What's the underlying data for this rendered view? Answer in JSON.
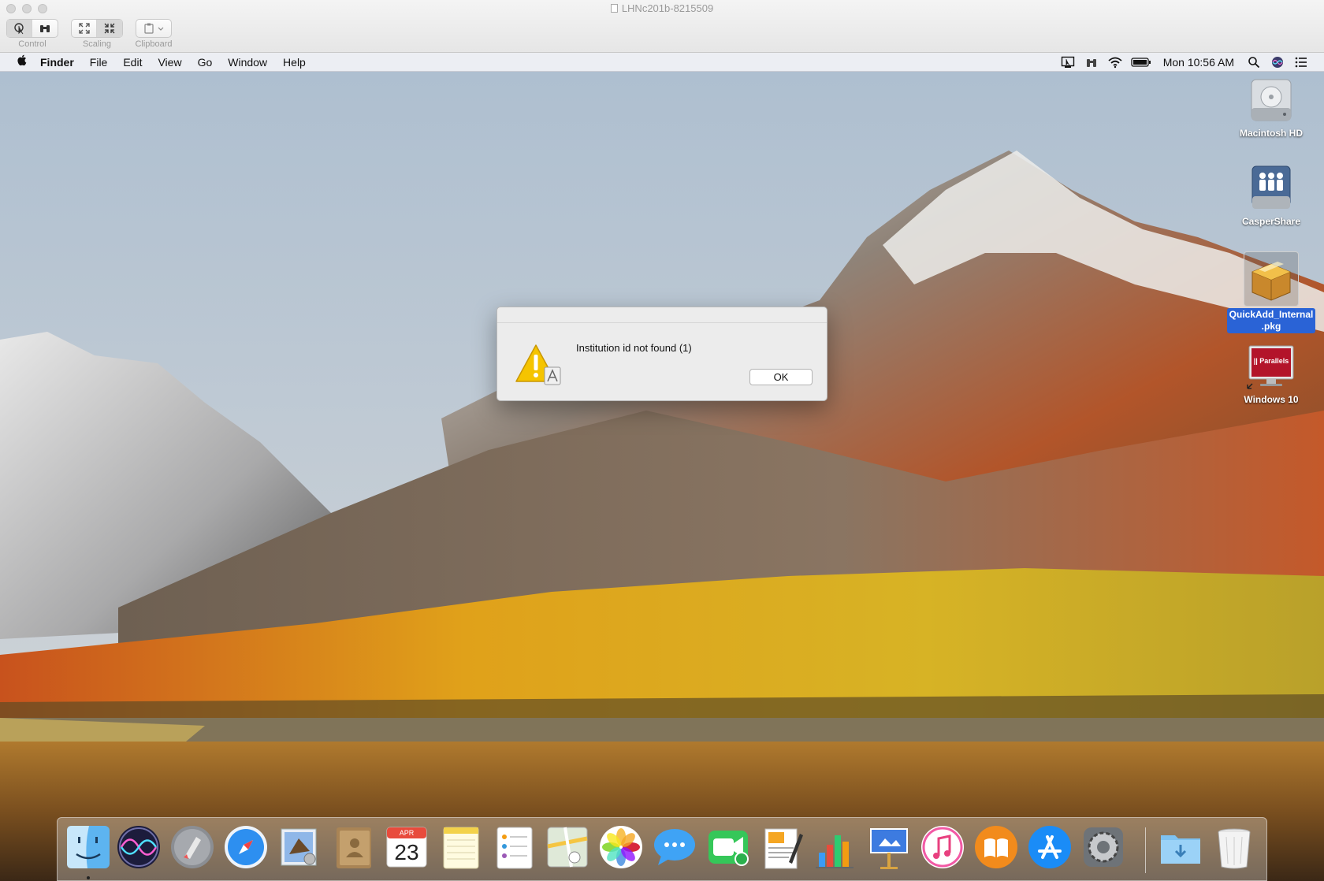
{
  "viewer": {
    "title": "LHNc201b-8215509",
    "tools": {
      "control_label": "Control",
      "scaling_label": "Scaling",
      "clipboard_label": "Clipboard"
    }
  },
  "menubar": {
    "app_name": "Finder",
    "items": [
      "File",
      "Edit",
      "View",
      "Go",
      "Window",
      "Help"
    ],
    "clock": "Mon 10:56 AM"
  },
  "alert": {
    "message": "Institution id not found (1)",
    "ok_label": "OK"
  },
  "desktop_icons": [
    {
      "label": "Macintosh HD"
    },
    {
      "label": "CasperShare"
    },
    {
      "label": "QuickAdd_Internal\n.pkg",
      "line1": "QuickAdd_Internal",
      "line2": ".pkg",
      "selected": true
    },
    {
      "label": "Windows 10",
      "badge": "|| Parallels"
    }
  ],
  "dock": {
    "calendar_month": "APR",
    "calendar_day": "23",
    "apps": [
      "finder-icon",
      "siri-icon",
      "launchpad-icon",
      "safari-icon",
      "mail-icon",
      "contacts-icon",
      "calendar-icon",
      "notes-icon",
      "reminders-icon",
      "maps-icon",
      "photos-icon",
      "messages-icon",
      "facetime-icon",
      "pages-icon",
      "numbers-icon",
      "keynote-icon",
      "itunes-icon",
      "ibooks-icon",
      "app-store-icon",
      "system-preferences-icon",
      "downloads-folder-icon",
      "trash-icon"
    ]
  },
  "colors": {
    "selection_blue": "#2a63d6",
    "warning_yellow": "#f5c400"
  }
}
